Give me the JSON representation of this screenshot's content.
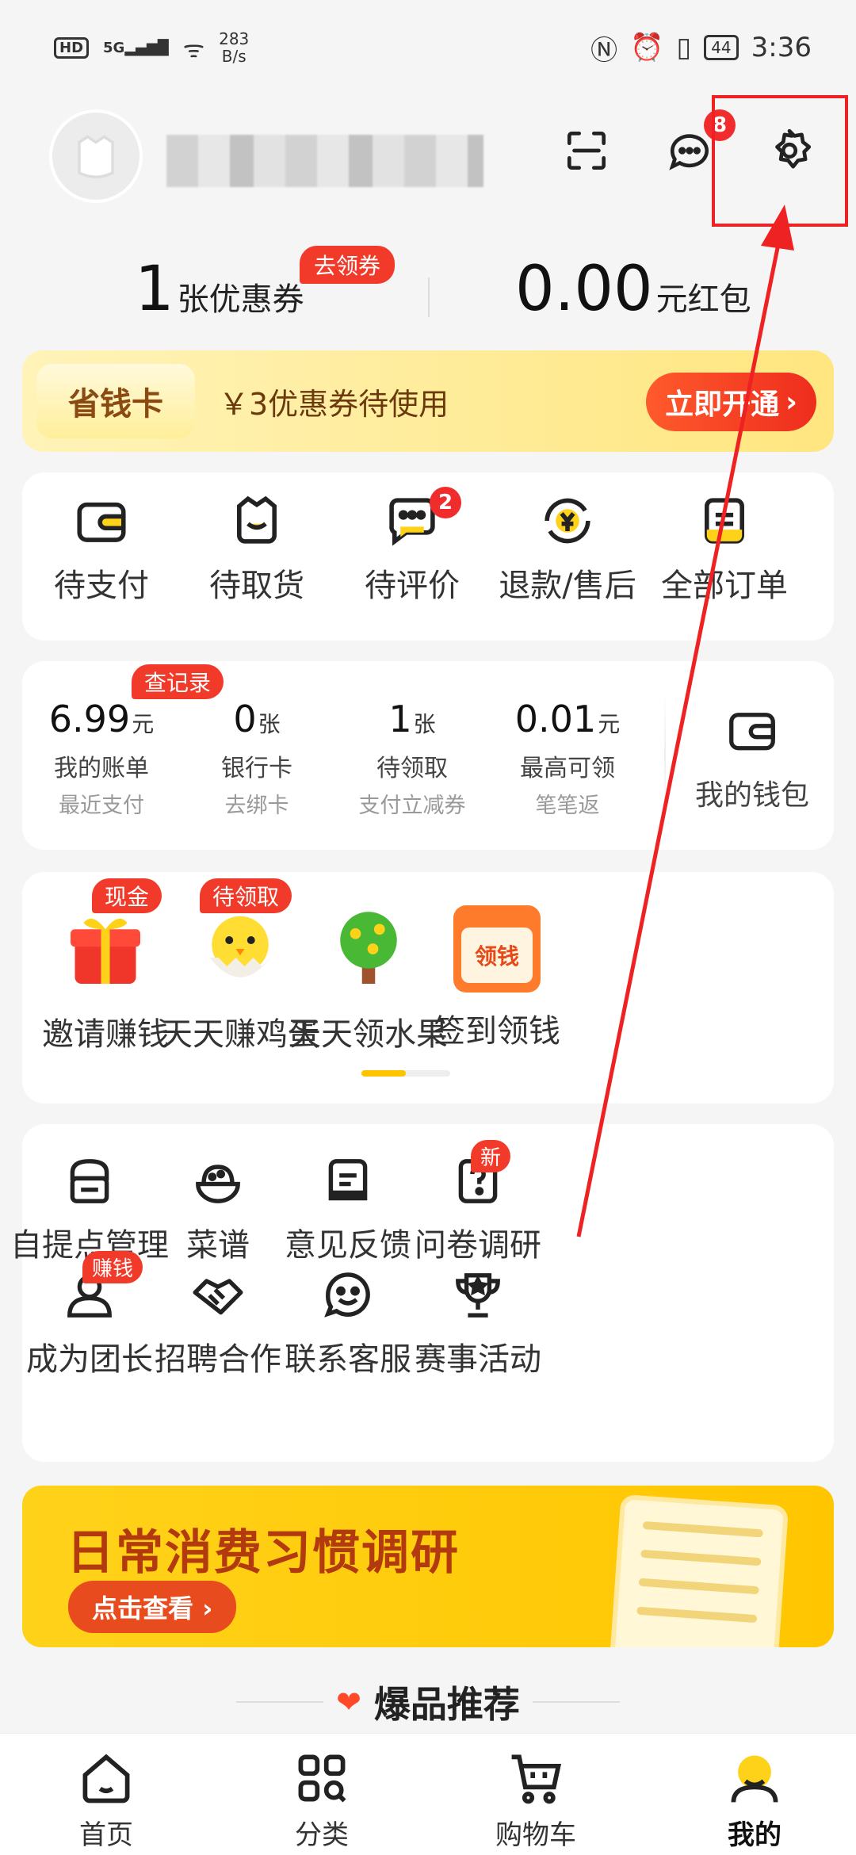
{
  "status_bar": {
    "hd": "HD",
    "net": "5G",
    "speed_value": "283",
    "speed_unit": "B/s",
    "battery": "44",
    "time": "3:36"
  },
  "header": {
    "message_badge": "8"
  },
  "summary": {
    "coupon_count": "1",
    "coupon_text": "张优惠券",
    "coupon_tag": "去领券",
    "redpacket_amount": "0.00",
    "redpacket_text": "元红包"
  },
  "save_card": {
    "tag": "省钱卡",
    "text": "￥3优惠券待使用",
    "button": "立即开通"
  },
  "orders": [
    {
      "label": "待支付",
      "icon": "wallet-icon"
    },
    {
      "label": "待取货",
      "icon": "bag-icon"
    },
    {
      "label": "待评价",
      "icon": "chat-bubble-icon",
      "badge": "2"
    },
    {
      "label": "退款/售后",
      "icon": "refund-icon"
    },
    {
      "label": "全部订单",
      "icon": "order-list-icon"
    }
  ],
  "wallet": {
    "items": [
      {
        "value": "6.99",
        "unit": "元",
        "label": "我的账单",
        "sub": "最近支付",
        "tag": "查记录"
      },
      {
        "value": "0",
        "unit": "张",
        "label": "银行卡",
        "sub": "去绑卡"
      },
      {
        "value": "1",
        "unit": "张",
        "label": "待领取",
        "sub": "支付立减券"
      },
      {
        "value": "0.01",
        "unit": "元",
        "label": "最高可领",
        "sub": "笔笔返"
      }
    ],
    "my_wallet": "我的钱包"
  },
  "promo": [
    {
      "label": "邀请赚钱",
      "tag": "现金",
      "icon": "gift-box-icon"
    },
    {
      "label": "天天赚鸡蛋",
      "tag": "待领取",
      "icon": "chick-icon"
    },
    {
      "label": "天天领水果",
      "icon": "fruit-tree-icon"
    },
    {
      "label": "签到领钱",
      "icon": "calendar-coin-icon",
      "icon_text": "领钱"
    }
  ],
  "promo_progress": 0.5,
  "tools": [
    {
      "label": "自提点管理",
      "icon": "store-icon"
    },
    {
      "label": "菜谱",
      "icon": "rice-bowl-icon"
    },
    {
      "label": "意见反馈",
      "icon": "feedback-icon"
    },
    {
      "label": "问卷调研",
      "icon": "survey-icon",
      "tag": "新"
    },
    {
      "label": "成为团长",
      "icon": "leader-icon",
      "tag": "赚钱"
    },
    {
      "label": "招聘合作",
      "icon": "handshake-icon"
    },
    {
      "label": "联系客服",
      "icon": "service-smile-icon"
    },
    {
      "label": "赛事活动",
      "icon": "trophy-icon"
    }
  ],
  "banner": {
    "title": "日常消费习惯调研",
    "button": "点击查看"
  },
  "hot_section": {
    "title": "爆品推荐"
  },
  "tabbar": [
    {
      "label": "首页",
      "icon": "home-icon"
    },
    {
      "label": "分类",
      "icon": "category-icon"
    },
    {
      "label": "购物车",
      "icon": "cart-icon"
    },
    {
      "label": "我的",
      "icon": "profile-icon",
      "active": true
    }
  ],
  "colors": {
    "accent_red": "#f23a2a",
    "accent_yellow": "#ffc600",
    "annotation_red": "#ee2222"
  }
}
